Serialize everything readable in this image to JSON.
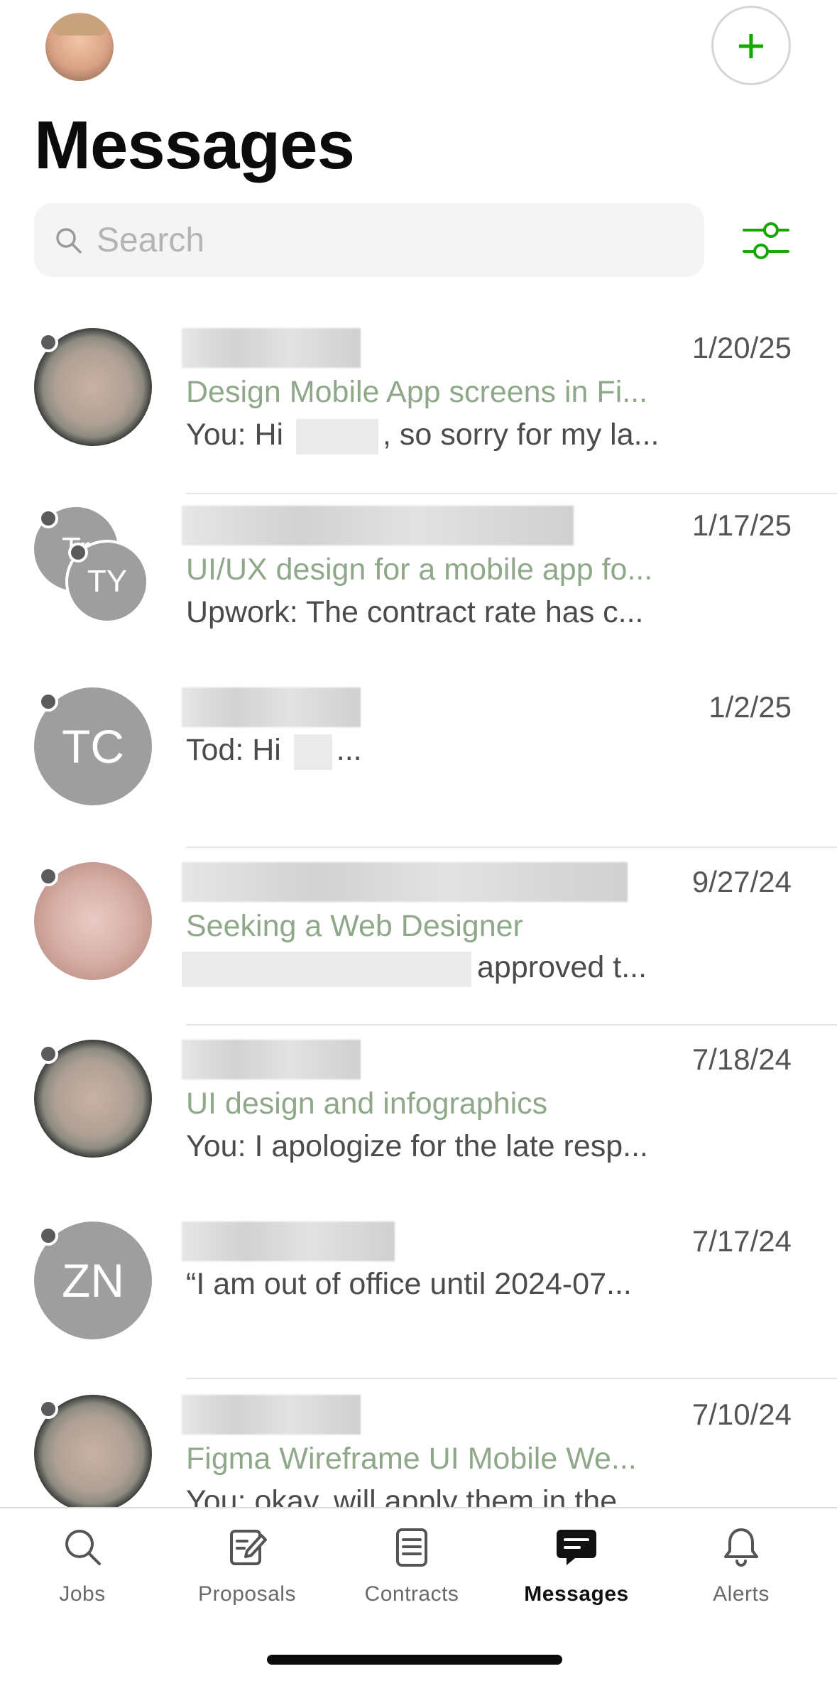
{
  "header": {
    "title": "Messages",
    "compose_label": "+"
  },
  "search": {
    "placeholder": "Search"
  },
  "colors": {
    "accent": "#14a800",
    "job_title": "#8fa889",
    "avatar_gray": "#9e9e9e"
  },
  "conversations": [
    {
      "date": "1/20/25",
      "job": "Design Mobile App screens in Fi...",
      "preview_a": "You: Hi ",
      "preview_b": ", so sorry for my la...",
      "avatar": "photo"
    },
    {
      "date": "1/17/25",
      "job": "UI/UX design for a mobile app fo...",
      "preview": "Upwork: The contract rate has c...",
      "initials_a": "Tr",
      "initials_b": "TY"
    },
    {
      "date": "1/2/25",
      "preview_a": "Tod: Hi ",
      "preview_b": "...",
      "initials": "TC"
    },
    {
      "date": "9/27/24",
      "job": "Seeking a Web Designer",
      "preview_b": "approved t...",
      "avatar": "photo"
    },
    {
      "date": "7/18/24",
      "job": "UI design and infographics",
      "preview": "You: I apologize for the late resp...",
      "avatar": "photo"
    },
    {
      "date": "7/17/24",
      "preview": "“I am out of office until 2024-07...",
      "initials": "ZN"
    },
    {
      "date": "7/10/24",
      "job": "Figma Wireframe UI Mobile We...",
      "preview": "You: okay, will apply them in the...",
      "avatar": "photo"
    }
  ],
  "nav": {
    "items": [
      {
        "label": "Jobs",
        "icon": "search-icon"
      },
      {
        "label": "Proposals",
        "icon": "proposal-edit-icon"
      },
      {
        "label": "Contracts",
        "icon": "contract-document-icon"
      },
      {
        "label": "Messages",
        "icon": "message-bubble-icon",
        "active": true
      },
      {
        "label": "Alerts",
        "icon": "bell-icon"
      }
    ]
  }
}
